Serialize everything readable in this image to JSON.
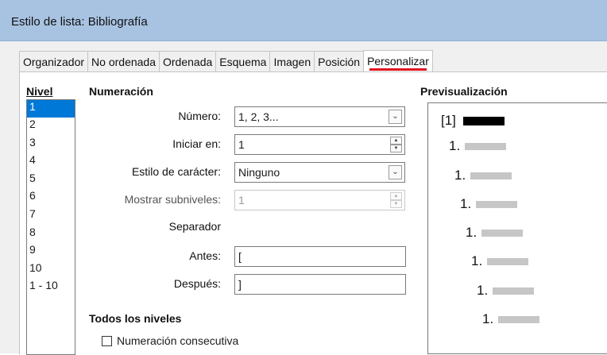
{
  "window": {
    "title": "Estilo de lista: Bibliografía"
  },
  "tabs": [
    {
      "label": "Organizador",
      "active": false
    },
    {
      "label": "No ordenada",
      "active": false
    },
    {
      "label": "Ordenada",
      "active": false
    },
    {
      "label": "Esquema",
      "active": false
    },
    {
      "label": "Imagen",
      "active": false
    },
    {
      "label": "Posición",
      "active": false
    },
    {
      "label": "Personalizar",
      "active": true
    }
  ],
  "level": {
    "heading": "Nivel",
    "items": [
      "1",
      "2",
      "3",
      "4",
      "5",
      "6",
      "7",
      "8",
      "9",
      "10",
      "1 - 10"
    ],
    "selected": "1"
  },
  "numbering": {
    "heading": "Numeración",
    "number_label": "Número:",
    "number_value": "1, 2, 3...",
    "start_label": "Iniciar en:",
    "start_value": "1",
    "char_style_label": "Estilo de carácter:",
    "char_style_value": "Ninguno",
    "sublevels_label": "Mostrar subniveles:",
    "sublevels_value": "1",
    "separator_label": "Separador",
    "before_label": "Antes:",
    "before_value": "[",
    "after_label": "Después:",
    "after_value": "]"
  },
  "all_levels": {
    "heading": "Todos los niveles",
    "consecutive_label": "Numeración consecutiva",
    "consecutive_checked": false
  },
  "preview": {
    "heading": "Previsualización",
    "lines": [
      "[1]",
      "1.",
      "1.",
      "1.",
      "1.",
      "1.",
      "1.",
      "1."
    ]
  }
}
